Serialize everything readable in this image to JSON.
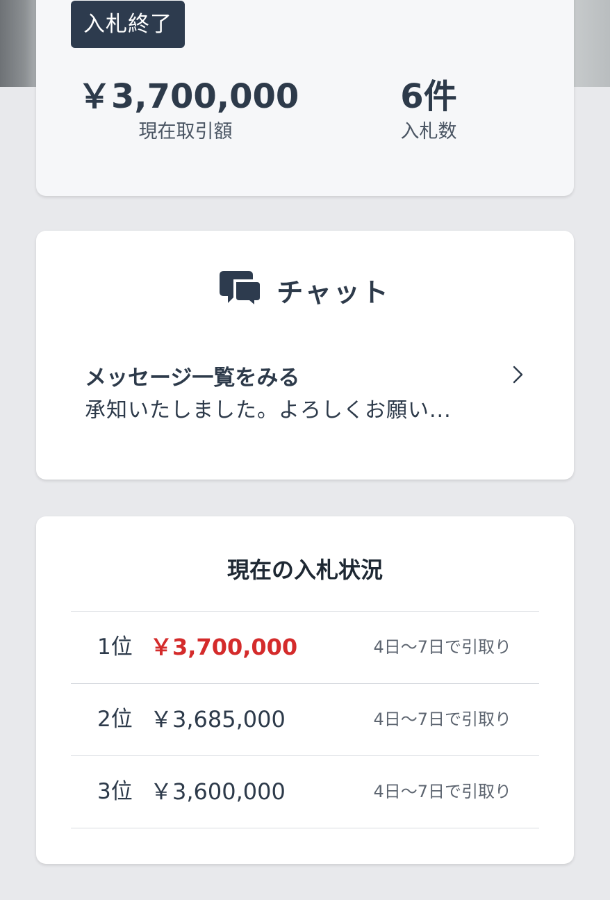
{
  "summary": {
    "status_badge": "入札終了",
    "price_value": "￥3,700,000",
    "price_label": "現在取引額",
    "bid_count_value": "6件",
    "bid_count_label": "入札数"
  },
  "chat": {
    "icon": "chat-bubbles-icon",
    "title": "チャット",
    "link_title": "メッセージ一覧をみる",
    "preview": "承知いたしました。よろしくお願い...",
    "chevron": "chevron-right-icon"
  },
  "bids": {
    "title": "現在の入札状況",
    "rows": [
      {
        "rank": "1位",
        "price": "￥3,700,000",
        "pickup": "4日〜7日で引取り"
      },
      {
        "rank": "2位",
        "price": "￥3,685,000",
        "pickup": "4日〜7日で引取り"
      },
      {
        "rank": "3位",
        "price": "￥3,600,000",
        "pickup": "4日〜7日で引取り"
      }
    ]
  },
  "colors": {
    "primary": "#2d3b4e",
    "highlight_price": "#d42b2b",
    "background": "#e8e9ec"
  }
}
